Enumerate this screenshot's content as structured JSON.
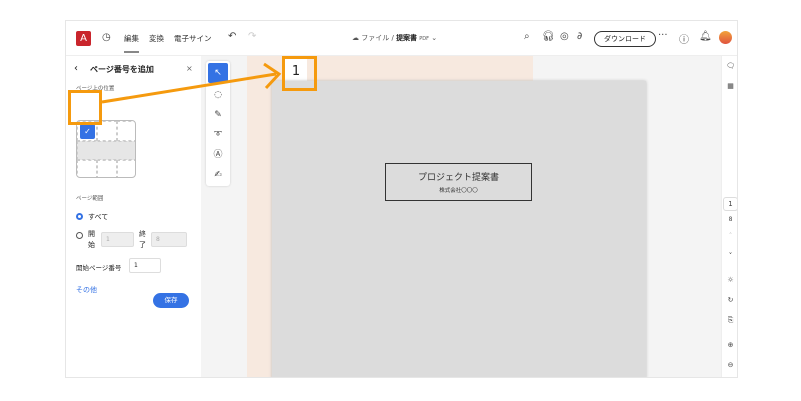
{
  "topbar": {
    "logo": "A",
    "tabs": [
      "編集",
      "変換",
      "電子サイン"
    ],
    "file_path": "ファイル",
    "separator": "/",
    "file_name": "提案書",
    "file_type": "PDF",
    "download": "ダウンロード",
    "more": "···"
  },
  "panel": {
    "title": "ページ番号を追加",
    "close": "×",
    "position_label": "ページ上の位置",
    "range_label": "ページ範囲",
    "all": "すべて",
    "start": "開始",
    "start_value": "1",
    "end": "終了",
    "end_value": "8",
    "start_page_label": "開始ページ番号",
    "start_page_value": "1",
    "other": "その他",
    "save": "保存"
  },
  "page": {
    "number": "1",
    "doc_title": "プロジェクト提案書",
    "company": "株式会社〇〇〇"
  },
  "right": {
    "current_page": "1",
    "total_pages": "8"
  },
  "colors": {
    "accent": "#3472e4",
    "annotation": "#f59a0e",
    "adobe_red": "#c9252c"
  }
}
